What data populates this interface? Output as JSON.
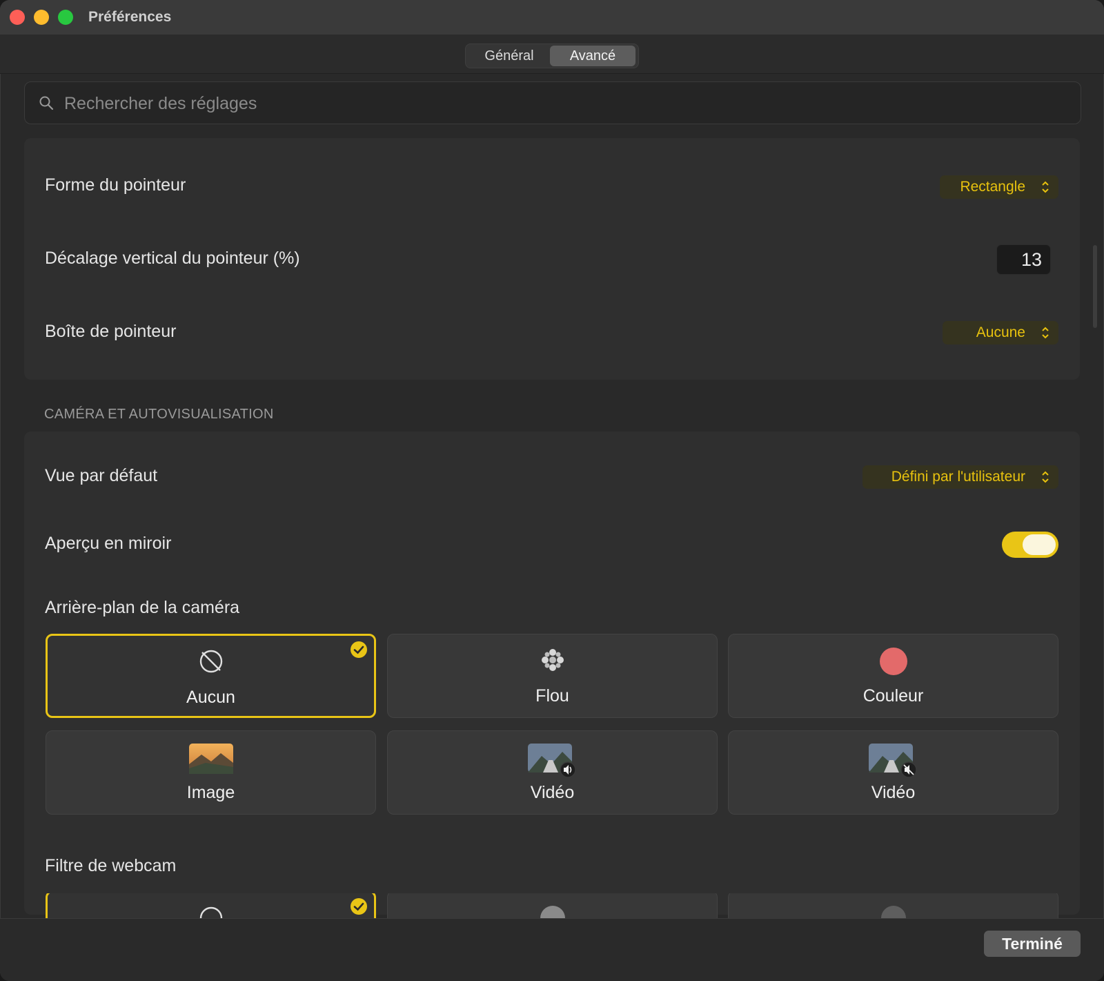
{
  "window": {
    "title": "Préférences"
  },
  "tabs": [
    {
      "label": "Général"
    },
    {
      "label": "Avancé"
    }
  ],
  "search": {
    "placeholder": "Rechercher des réglages",
    "value": ""
  },
  "pointer": {
    "shape_label": "Forme du pointeur",
    "shape_value": "Rectangle",
    "offset_label": "Décalage vertical du pointeur (%)",
    "offset_value": "13",
    "box_label": "Boîte de pointeur",
    "box_value": "Aucune"
  },
  "camera": {
    "section_title": "CAMÉRA ET AUTOVISUALISATION",
    "default_view_label": "Vue par défaut",
    "default_view_value": "Défini par l'utilisateur",
    "mirror_label": "Aperçu en miroir",
    "mirror_on": true,
    "background_label": "Arrière-plan de la caméra",
    "backgrounds": [
      {
        "label": "Aucun",
        "icon": "no-background-icon",
        "selected": true
      },
      {
        "label": "Flou",
        "icon": "blur-icon",
        "selected": false
      },
      {
        "label": "Couleur",
        "icon": "color-swatch-icon",
        "selected": false
      },
      {
        "label": "Image",
        "icon": "landscape-image-icon",
        "selected": false
      },
      {
        "label": "Vidéo",
        "icon": "video-with-sound-icon",
        "selected": false
      },
      {
        "label": "Vidéo",
        "icon": "video-muted-icon",
        "selected": false
      }
    ],
    "filter_label": "Filtre de webcam"
  },
  "footer": {
    "done_label": "Terminé"
  },
  "colors": {
    "accent": "#e9c516",
    "swatch": "#e36a6a"
  }
}
